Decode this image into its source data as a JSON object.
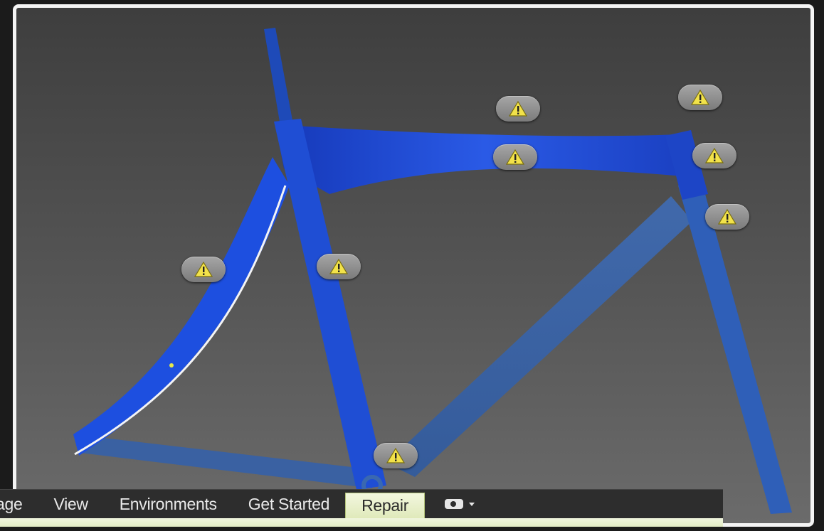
{
  "viewport": {
    "name": "3D model viewport"
  },
  "warnings": [
    {
      "id": "w1",
      "icon": "warning-icon"
    },
    {
      "id": "w2",
      "icon": "warning-icon"
    },
    {
      "id": "w3",
      "icon": "warning-icon"
    },
    {
      "id": "w4",
      "icon": "warning-icon"
    },
    {
      "id": "w5",
      "icon": "warning-icon"
    },
    {
      "id": "w6",
      "icon": "warning-icon"
    },
    {
      "id": "w7",
      "icon": "warning-icon"
    },
    {
      "id": "w8",
      "icon": "warning-icon"
    },
    {
      "id": "w9",
      "icon": "warning-icon"
    }
  ],
  "ribbon": {
    "tabs": [
      {
        "label": "age"
      },
      {
        "label": "View"
      },
      {
        "label": "Environments"
      },
      {
        "label": "Get Started"
      },
      {
        "label": "Repair",
        "active": true
      }
    ],
    "extra_icon": "camera-icon"
  },
  "colors": {
    "frame_blue": "#1f4fd8",
    "frame_dim_blue": "#3a68b0",
    "warning_yellow": "#f2e24a",
    "active_tab": "#e6eec8"
  }
}
